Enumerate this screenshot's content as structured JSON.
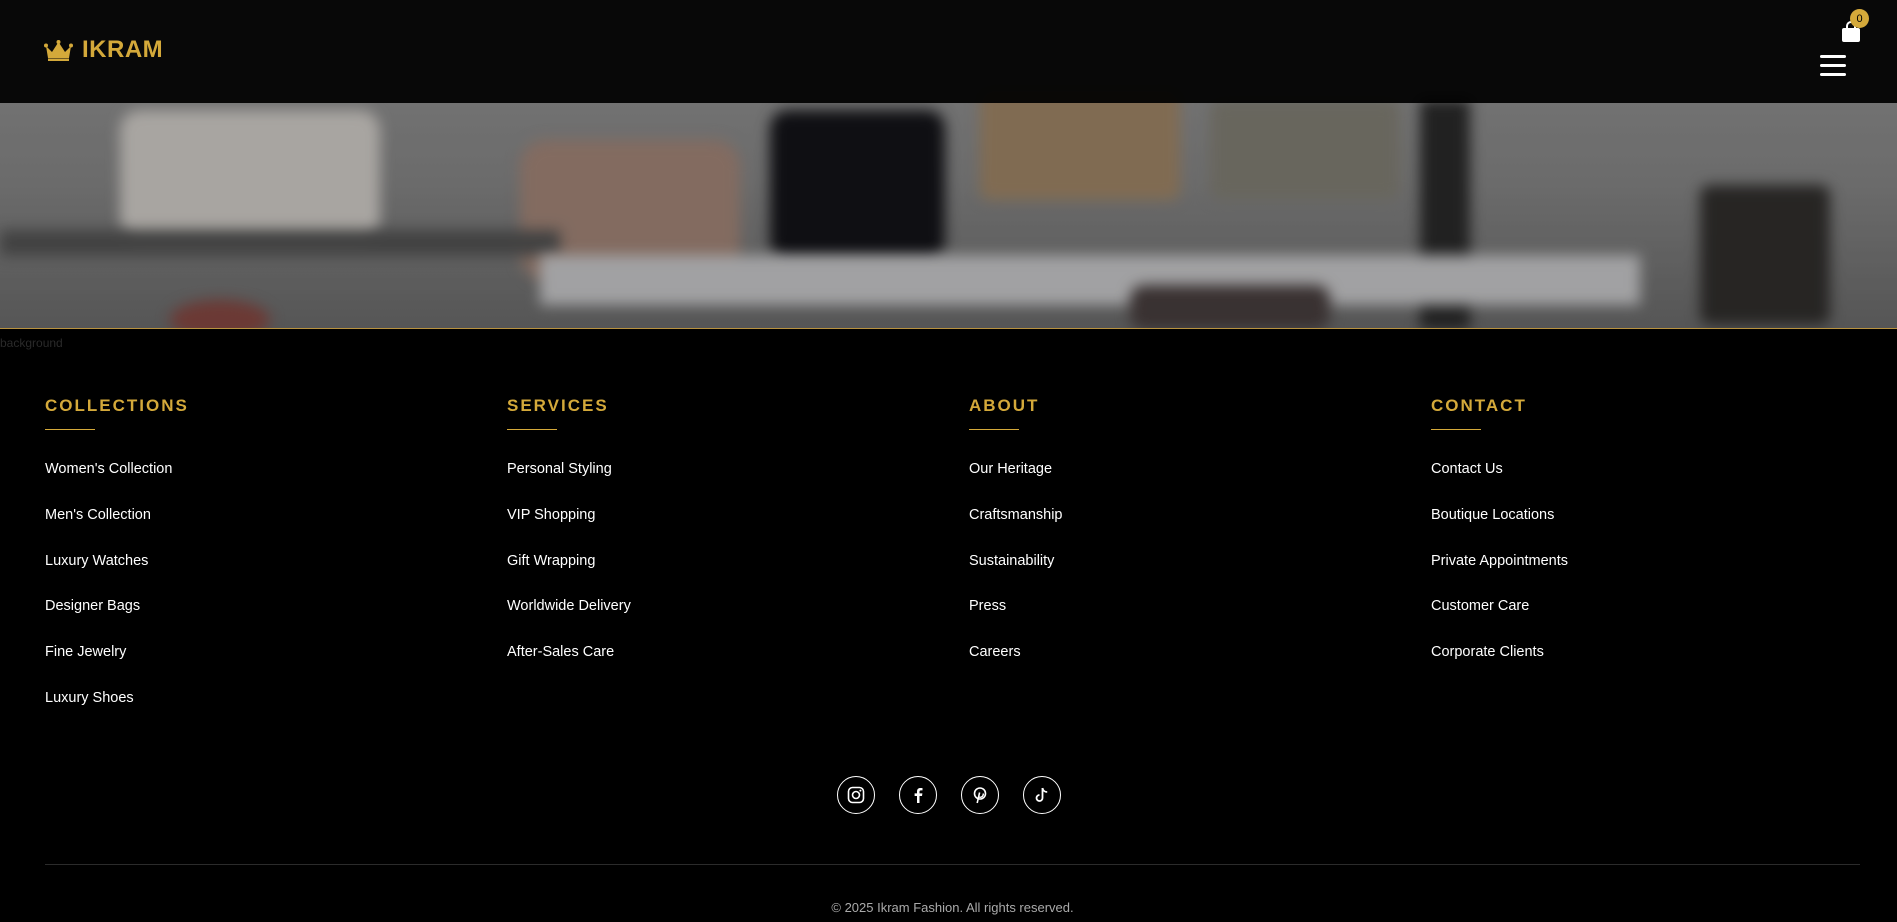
{
  "header": {
    "brand": "IKRAM",
    "cart_count": "0"
  },
  "hero": {
    "image_caption": "background"
  },
  "footer": {
    "columns": [
      {
        "title": "COLLECTIONS",
        "links": [
          "Women's Collection",
          "Men's Collection",
          "Luxury Watches",
          "Designer Bags",
          "Fine Jewelry",
          "Luxury Shoes"
        ]
      },
      {
        "title": "SERVICES",
        "links": [
          "Personal Styling",
          "VIP Shopping",
          "Gift Wrapping",
          "Worldwide Delivery",
          "After-Sales Care"
        ]
      },
      {
        "title": "ABOUT",
        "links": [
          "Our Heritage",
          "Craftsmanship",
          "Sustainability",
          "Press",
          "Careers"
        ]
      },
      {
        "title": "CONTACT",
        "links": [
          "Contact Us",
          "Boutique Locations",
          "Private Appointments",
          "Customer Care",
          "Corporate Clients"
        ]
      }
    ],
    "socials": [
      "instagram-icon",
      "facebook-icon",
      "pinterest-icon",
      "tiktok-icon"
    ],
    "copyright": "© 2025 Ikram Fashion. All rights reserved."
  },
  "colors": {
    "accent": "#d4a93a",
    "background": "#000000",
    "text": "#ffffff",
    "muted": "#aaaaaa"
  }
}
